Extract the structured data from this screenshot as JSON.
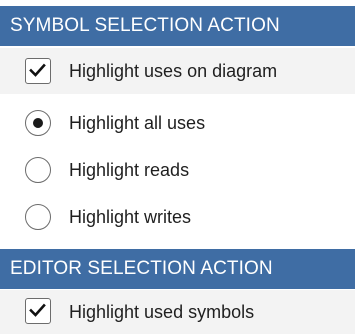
{
  "sections": [
    {
      "title": "SYMBOL SELECTION ACTION",
      "options": [
        {
          "control": "checkbox",
          "checked": true,
          "label": "Highlight uses on diagram"
        },
        {
          "control": "radio",
          "checked": true,
          "label": "Highlight all uses"
        },
        {
          "control": "radio",
          "checked": false,
          "label": "Highlight reads"
        },
        {
          "control": "radio",
          "checked": false,
          "label": "Highlight writes"
        }
      ]
    },
    {
      "title": "EDITOR SELECTION ACTION",
      "options": [
        {
          "control": "checkbox",
          "checked": true,
          "label": "Highlight used symbols"
        }
      ]
    }
  ],
  "colors": {
    "header_bg": "#3f6da4",
    "header_text": "#ffffff",
    "stripe_bg": "#f3f3f3"
  }
}
